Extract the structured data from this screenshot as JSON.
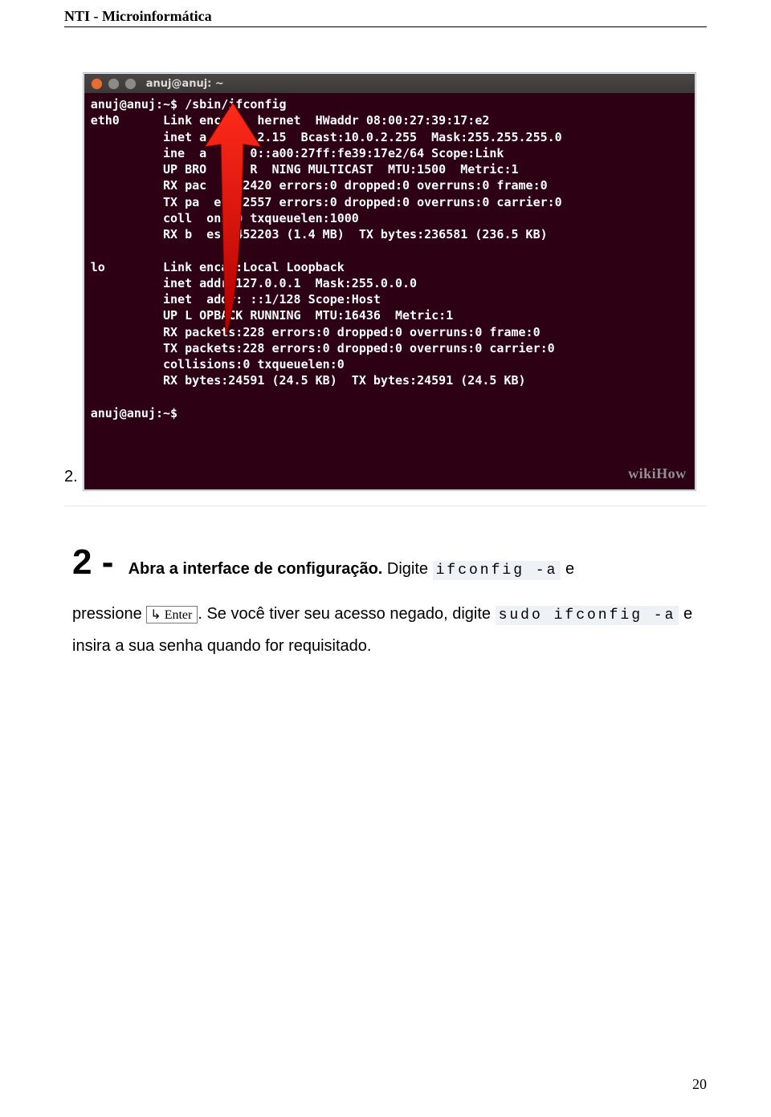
{
  "header": {
    "title": "NTI - Microinformática"
  },
  "step_marker": "2.",
  "terminal": {
    "window_title": "anuj@anuj: ~",
    "watermark": "wikiHow",
    "lines": [
      "anuj@anuj:~$ /sbin/ifconfig",
      "eth0      Link enca    hernet  HWaddr 08:00:27:39:17:e2",
      "          inet a      .2.15  Bcast:10.0.2.255  Mask:255.255.255.0",
      "          ine  a      0::a00:27ff:fe39:17e2/64 Scope:Link",
      "          UP BRO  AST R  NING MULTICAST  MTU:1500  Metric:1",
      "          RX pac  ts:2420 errors:0 dropped:0 overruns:0 frame:0",
      "          TX pa  ets:2557 errors:0 dropped:0 overruns:0 carrier:0",
      "          coll  ons:0 txqueuelen:1000",
      "          RX b  es:1452203 (1.4 MB)  TX bytes:236581 (236.5 KB)",
      "",
      "lo        Link encap:Local Loopback",
      "          inet addr:127.0.0.1  Mask:255.0.0.0",
      "          inet  addr: ::1/128 Scope:Host",
      "          UP L OPBACK RUNNING  MTU:16436  Metric:1",
      "          RX packets:228 errors:0 dropped:0 overruns:0 frame:0",
      "          TX packets:228 errors:0 dropped:0 overruns:0 carrier:0",
      "          collisions:0 txqueuelen:0",
      "          RX bytes:24591 (24.5 KB)  TX bytes:24591 (24.5 KB)",
      "",
      "anuj@anuj:~$"
    ]
  },
  "instruction": {
    "step_label": "2 - ",
    "bold_part": "Abra a interface de configuração.",
    "after_bold_1": " Digite ",
    "code1": "ifconfig -a",
    "after_code1": " e",
    "line2_a": "pressione ",
    "key_symbol": "↳",
    "key_label": "Enter",
    "line2_b": ". Se você tiver seu acesso negado, digite ",
    "code2": "sudo ifconfig -a",
    "line2_c": " e",
    "line3": "insira a sua senha quando for requisitado."
  },
  "page_number": "20"
}
